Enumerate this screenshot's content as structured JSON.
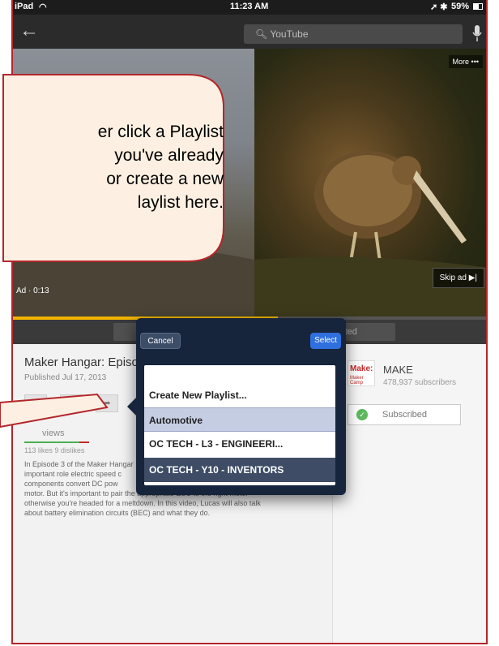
{
  "status_bar": {
    "device": "iPad",
    "time": "11:23 AM",
    "battery": "59%"
  },
  "nav": {
    "search_placeholder": "YouTube"
  },
  "video": {
    "more_label": "More •••",
    "skip_label": "Skip ad ▶|",
    "ad_time": "Ad · 0:13",
    "progress_fraction": 0.56
  },
  "tabs": {
    "partial_label": "ested"
  },
  "details": {
    "title": "Maker Hangar: Episo",
    "published": "Published Jul 17, 2013",
    "views": "views",
    "likes": "113 likes",
    "dislikes": "9 dislikes",
    "description": "In Episode 3 of the Maker Hangar\nimportant role electric speed c\ncomponents convert DC pow\nmotor. But it's important to pair the appropriate ESC to the right motor\notherwise you're headed for a meltdown. In this video, Lucas will also talk\nabout battery elimination circuits (BEC) and what they do."
  },
  "channel": {
    "logo_text": "Make:",
    "logo_sub": "Maker Camp",
    "name": "MAKE",
    "subscribers": "478,937 subscribers",
    "subscribed_label": "Subscribed"
  },
  "playlist_popover": {
    "cancel": "Cancel",
    "select": "Select",
    "items": [
      "Create New Playlist...",
      "Automotive",
      "OC TECH - L3 - ENGINEERI...",
      "OC TECH - Y10 - INVENTORS"
    ]
  },
  "callout": {
    "text": "er click a Playlist\nyou've already\n or create a new\nlaylist here."
  },
  "colors": {
    "frame_border": "#b3262b",
    "callout_fill": "#fdf0e2",
    "callout_border": "#b3262b",
    "popover_bg": "#16243c",
    "select_button": "#2f6fde",
    "progress": "#f0b400"
  }
}
